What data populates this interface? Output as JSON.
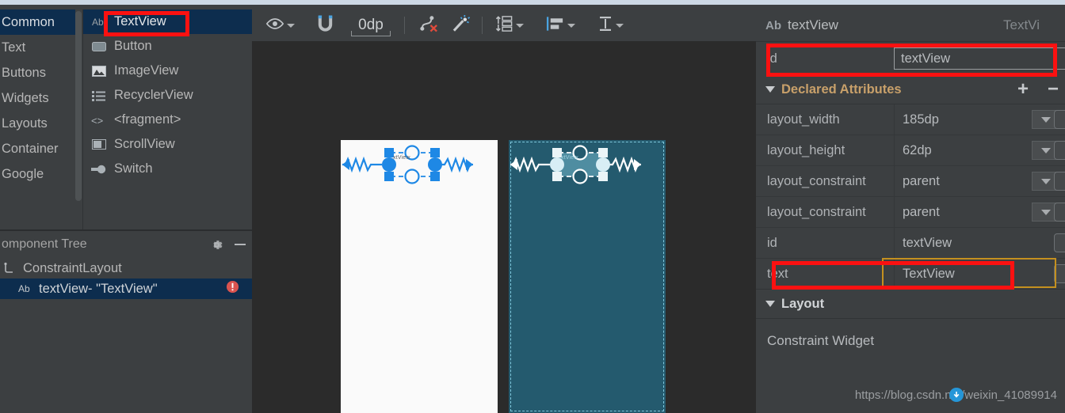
{
  "palette": {
    "categories": [
      {
        "label": "Common",
        "selected": true
      },
      {
        "label": "Text",
        "selected": false
      },
      {
        "label": "Buttons",
        "selected": false
      },
      {
        "label": "Widgets",
        "selected": false
      },
      {
        "label": "Layouts",
        "selected": false
      },
      {
        "label": "Container",
        "selected": false
      },
      {
        "label": "Google",
        "selected": false
      }
    ],
    "items": [
      {
        "label": "TextView",
        "icon": "textview-icon",
        "selected": true
      },
      {
        "label": "Button",
        "icon": "button-icon",
        "selected": false
      },
      {
        "label": "ImageView",
        "icon": "imageview-icon",
        "selected": false
      },
      {
        "label": "RecyclerView",
        "icon": "recyclerview-icon",
        "selected": false
      },
      {
        "label": "<fragment>",
        "icon": "fragment-icon",
        "selected": false
      },
      {
        "label": "ScrollView",
        "icon": "scrollview-icon",
        "selected": false
      },
      {
        "label": "Switch",
        "icon": "switch-icon",
        "selected": false
      }
    ]
  },
  "component_tree": {
    "title": "omponent Tree",
    "gear_icon": "gear-icon",
    "minimize_icon": "minimize-icon",
    "nodes": [
      {
        "label": "ConstraintLayout",
        "icon": "constraintlayout-icon",
        "selected": false,
        "error": false
      },
      {
        "label": "textView- \"TextView\"",
        "icon": "ab-icon",
        "selected": true,
        "error": true
      }
    ]
  },
  "toolbar": {
    "visibility_label": "eye-icon",
    "autoconnect_label": "magnet-icon",
    "default_margin": "0dp",
    "clear_constraints_label": "clear-constraints-icon",
    "infer_constraints_label": "magic-wand-icon",
    "pack_label": "pack-icon",
    "align_label": "align-icon",
    "guidelines_label": "guidelines-icon"
  },
  "canvas": {
    "design_surface_label": "design-view",
    "blueprint_surface_label": "blueprint-view",
    "widget_label": "xtView"
  },
  "attributes": {
    "header": {
      "icon": "ab-icon",
      "name": "textView",
      "type": "TextVi"
    },
    "id_row": {
      "key": "id",
      "value": "textView"
    },
    "declared_section": {
      "title": "Declared Attributes",
      "add_label": "+",
      "remove_label": "−"
    },
    "rows": [
      {
        "key": "layout_width",
        "value": "185dp",
        "dropdown": true
      },
      {
        "key": "layout_height",
        "value": "62dp",
        "dropdown": true
      },
      {
        "key": "layout_constraint",
        "value": "parent",
        "dropdown": true
      },
      {
        "key": "layout_constraint",
        "value": "parent",
        "dropdown": true
      },
      {
        "key": "id",
        "value": "textView",
        "dropdown": false
      },
      {
        "key": "text",
        "value": "TextView",
        "dropdown": false,
        "focused": true
      }
    ],
    "layout_section": {
      "title": "Layout",
      "constraint_widget_label": "Constraint Widget"
    }
  },
  "watermark": {
    "text": "https://blog.csdn.net/weixin_41089914",
    "icon": "csdn-icon"
  },
  "colors": {
    "panel_bg": "#3c3f41",
    "canvas_bg": "#2b2b2b",
    "selection_blue": "#0d2d4e",
    "accent_blue": "#1e88e5",
    "blueprint_bg": "#245a6e",
    "highlight_red": "#fb1111",
    "focus_gold": "#c4901f",
    "section_gold": "#c8a06a",
    "error_red": "#d9534f"
  }
}
